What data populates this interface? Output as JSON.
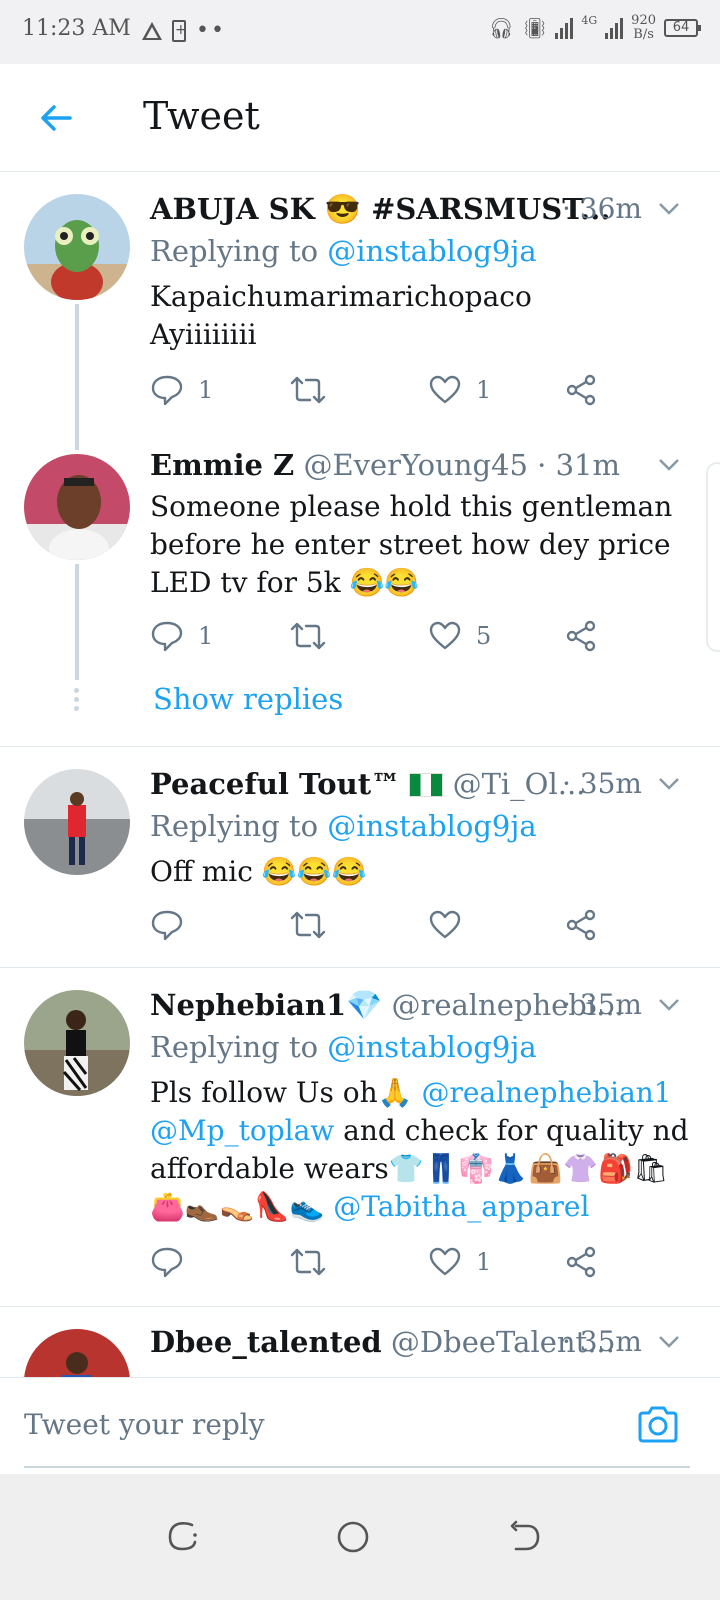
{
  "status_bar": {
    "time": "11:23 AM",
    "network_speed_value": "920",
    "network_speed_unit": "B/s",
    "battery": "64",
    "network_type": "4G"
  },
  "header": {
    "title": "Tweet"
  },
  "tweets": [
    {
      "name": "ABUJA SK 😎 #SARSMUST...",
      "handle": "",
      "time": "· 36m",
      "replying_prefix": "Replying to ",
      "replying_to": "@instablog9ja",
      "text_lines": [
        "Kapaichumarimarichopaco",
        "Ayiiiiiiii"
      ],
      "reply_count": "1",
      "retweet_count": "",
      "like_count": "1"
    },
    {
      "name": "Emmie Z",
      "handle": "@EverYoung45",
      "time": "· 31m",
      "text_lines": [
        "Someone please hold this gentleman",
        "before he enter street how dey price",
        "LED tv for 5k 😂😂"
      ],
      "reply_count": "1",
      "retweet_count": "",
      "like_count": "5",
      "show_replies": "Show replies"
    },
    {
      "name": "Peaceful Tout™",
      "handle": "@Ti_Ol...",
      "time": "· 35m",
      "replying_prefix": "Replying to ",
      "replying_to": "@instablog9ja",
      "text_lines": [
        "Off mic 😂😂😂"
      ],
      "reply_count": "",
      "retweet_count": "",
      "like_count": ""
    },
    {
      "name": "Nephebian1💎",
      "handle": "@realnephebi...",
      "time": "· 35m",
      "replying_prefix": "Replying to ",
      "replying_to": "@instablog9ja",
      "text_part1": "Pls follow Us oh🙏 ",
      "mention1": "@realnephebian1",
      "mention2": "@Mp_toplaw",
      "text_part2": "  and check for quality nd",
      "text_line3": "affordable wears👕👖👘👗👜👚🎒🛍",
      "text_line4": "👛👞👡👠👟 ",
      "mention3": "@Tabitha_apparel",
      "reply_count": "",
      "retweet_count": "",
      "like_count": "1"
    },
    {
      "name": "Dbee_talented",
      "handle": "@DbeeTalent...",
      "time": "· 35m"
    }
  ],
  "reply_bar": {
    "placeholder": "Tweet your reply"
  },
  "colors": {
    "accent": "#1da1f2",
    "muted": "#657786",
    "text": "#14171a"
  },
  "icons": [
    "back-arrow-icon",
    "reply-icon",
    "retweet-icon",
    "like-icon",
    "share-icon",
    "chevron-down-icon",
    "camera-icon"
  ]
}
